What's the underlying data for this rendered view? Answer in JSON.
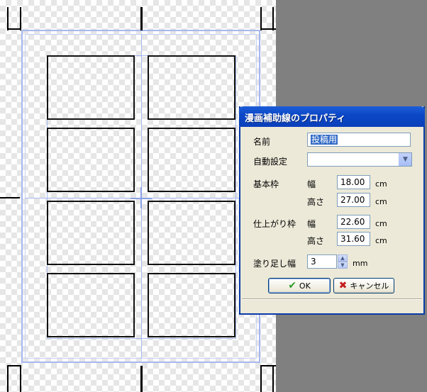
{
  "dialog": {
    "title": "漫画補助線のプロパティ",
    "name_label": "名前",
    "name_value": "投稿用",
    "auto_label": "自動設定",
    "auto_value": "",
    "base_frame_label": "基本枠",
    "finished_frame_label": "仕上がり枠",
    "width_label": "幅",
    "height_label": "高さ",
    "base_width": "18.00",
    "base_height": "27.00",
    "finished_width": "22.60",
    "finished_height": "31.60",
    "bleed_label": "塗り足し幅",
    "bleed_value": "3",
    "unit_cm": "cm",
    "unit_mm": "mm",
    "ok_label": "OK",
    "cancel_label": "キャンセル"
  },
  "icons": {
    "ok": "check-icon",
    "cancel": "x-icon",
    "dropdown": "chevron-down-icon",
    "spin_up": "triangle-up-icon",
    "spin_down": "triangle-down-icon"
  },
  "colors": {
    "titlebar": "#0b48c7",
    "dialog_bg": "#ece9d8",
    "guide_blue": "#a7b8f0",
    "selection": "#316ac5",
    "workspace": "#808080"
  }
}
